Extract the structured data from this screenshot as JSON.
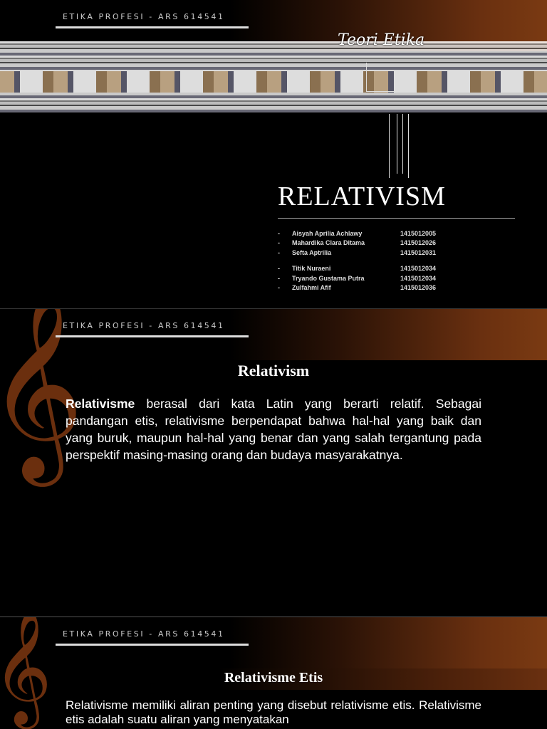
{
  "header": "ETIKA PROFESI - ARS 614541",
  "slide1": {
    "subtitle": "Teori Etika",
    "title": "RELATIVISM",
    "members": [
      {
        "name": "Aisyah Aprilia Achlawy",
        "id": "1415012005"
      },
      {
        "name": "Mahardika Clara Ditama",
        "id": "1415012026"
      },
      {
        "name": "Sefta Aptrilia",
        "id": "1415012031"
      },
      {
        "name": "Titik Nuraeni",
        "id": "1415012034"
      },
      {
        "name": "Tryando Gustama Putra",
        "id": "1415012034"
      },
      {
        "name": "Zulfahmi Afif",
        "id": "1415012036"
      }
    ],
    "dash": "-"
  },
  "slide2": {
    "title": "Relativism",
    "bold_term": "Relativisme",
    "body": " berasal dari kata Latin yang berarti relatif. Sebagai pandangan etis, relativisme berpendapat bahwa hal-hal yang baik dan yang buruk, maupun hal-hal yang benar dan yang salah tergantung pada perspektif masing-masing orang dan budaya masyarakatnya."
  },
  "slide3": {
    "title": "Relativisme Etis",
    "body": "Relativisme memiliki aliran penting yang disebut relativisme etis. Relativisme etis adalah suatu aliran yang menyatakan"
  },
  "clef": "𝄞"
}
